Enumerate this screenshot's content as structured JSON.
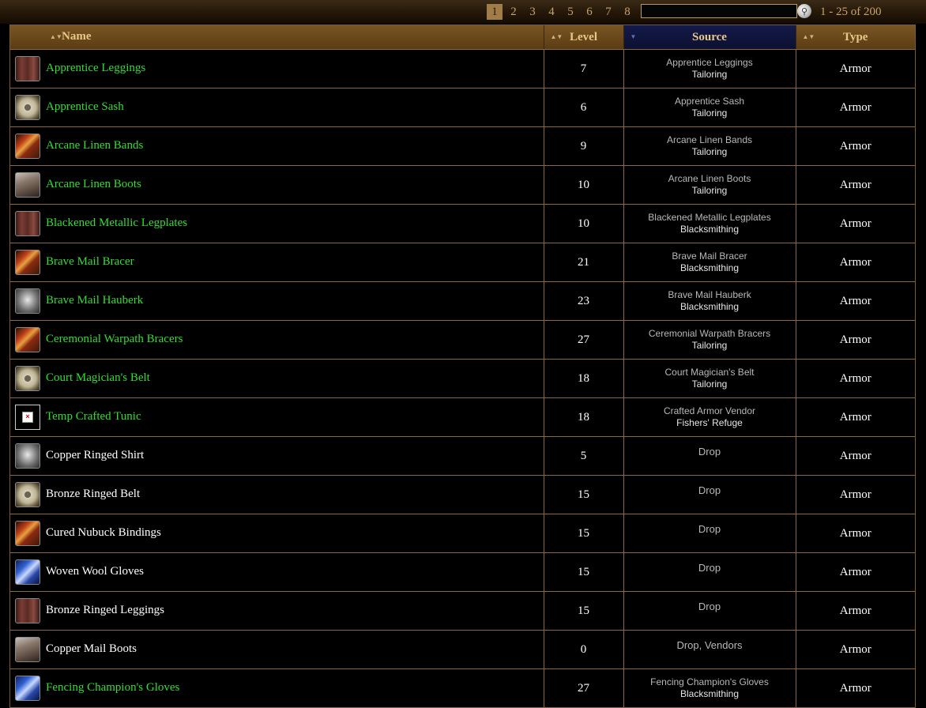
{
  "pagination": {
    "pages": [
      "1",
      "2",
      "3",
      "4",
      "5",
      "6",
      "7",
      "8"
    ],
    "current": "1",
    "range_text": "1 - 25 of 200",
    "search_value": ""
  },
  "columns": {
    "name": "Name",
    "level": "Level",
    "source": "Source",
    "type": "Type",
    "active_sort": "source"
  },
  "colors": {
    "crafted_name": "#33dd33",
    "plain_name": "#ffffff",
    "header_bg": "#6a4a1a",
    "active_header_bg": "#0c1030",
    "border": "#8a6a3a"
  },
  "rows": [
    {
      "icon": "leggings-icon",
      "name": "Apprentice Leggings",
      "crafted": true,
      "level": "7",
      "source": "Apprentice Leggings",
      "source_detail": "Tailoring",
      "type": "Armor"
    },
    {
      "icon": "sash-icon",
      "name": "Apprentice Sash",
      "crafted": true,
      "level": "6",
      "source": "Apprentice Sash",
      "source_detail": "Tailoring",
      "type": "Armor"
    },
    {
      "icon": "bracer-icon",
      "name": "Arcane Linen Bands",
      "crafted": true,
      "level": "9",
      "source": "Arcane Linen Bands",
      "source_detail": "Tailoring",
      "type": "Armor"
    },
    {
      "icon": "boots-icon",
      "name": "Arcane Linen Boots",
      "crafted": true,
      "level": "10",
      "source": "Arcane Linen Boots",
      "source_detail": "Tailoring",
      "type": "Armor"
    },
    {
      "icon": "leggings-icon",
      "name": "Blackened Metallic Legplates",
      "crafted": true,
      "level": "10",
      "source": "Blackened Metallic Legplates",
      "source_detail": "Blacksmithing",
      "type": "Armor"
    },
    {
      "icon": "bracer-icon",
      "name": "Brave Mail Bracer",
      "crafted": true,
      "level": "21",
      "source": "Brave Mail Bracer",
      "source_detail": "Blacksmithing",
      "type": "Armor"
    },
    {
      "icon": "chest-icon",
      "name": "Brave Mail Hauberk",
      "crafted": true,
      "level": "23",
      "source": "Brave Mail Hauberk",
      "source_detail": "Blacksmithing",
      "type": "Armor"
    },
    {
      "icon": "bracer-icon",
      "name": "Ceremonial Warpath Bracers",
      "crafted": true,
      "level": "27",
      "source": "Ceremonial Warpath Bracers",
      "source_detail": "Tailoring",
      "type": "Armor"
    },
    {
      "icon": "sash-icon",
      "name": "Court Magician's Belt",
      "crafted": true,
      "level": "18",
      "source": "Court Magician's Belt",
      "source_detail": "Tailoring",
      "type": "Armor"
    },
    {
      "icon": "missing-image-icon",
      "name": "Temp Crafted Tunic",
      "crafted": true,
      "level": "18",
      "source": "Crafted Armor Vendor",
      "source_detail": "Fishers' Refuge",
      "type": "Armor"
    },
    {
      "icon": "chest-icon",
      "name": "Copper Ringed Shirt",
      "crafted": false,
      "level": "5",
      "source": "Drop",
      "source_detail": "",
      "type": "Armor"
    },
    {
      "icon": "sash-icon",
      "name": "Bronze Ringed Belt",
      "crafted": false,
      "level": "15",
      "source": "Drop",
      "source_detail": "",
      "type": "Armor"
    },
    {
      "icon": "bracer-icon",
      "name": "Cured Nubuck Bindings",
      "crafted": false,
      "level": "15",
      "source": "Drop",
      "source_detail": "",
      "type": "Armor"
    },
    {
      "icon": "gloves-icon",
      "name": "Woven Wool Gloves",
      "crafted": false,
      "level": "15",
      "source": "Drop",
      "source_detail": "",
      "type": "Armor"
    },
    {
      "icon": "leggings-icon",
      "name": "Bronze Ringed Leggings",
      "crafted": false,
      "level": "15",
      "source": "Drop",
      "source_detail": "",
      "type": "Armor"
    },
    {
      "icon": "boots-icon",
      "name": "Copper Mail Boots",
      "crafted": false,
      "level": "0",
      "source": "Drop, Vendors",
      "source_detail": "",
      "type": "Armor"
    },
    {
      "icon": "gloves-icon",
      "name": "Fencing Champion's Gloves",
      "crafted": true,
      "level": "27",
      "source": "Fencing Champion's Gloves",
      "source_detail": "Blacksmithing",
      "type": "Armor"
    }
  ]
}
